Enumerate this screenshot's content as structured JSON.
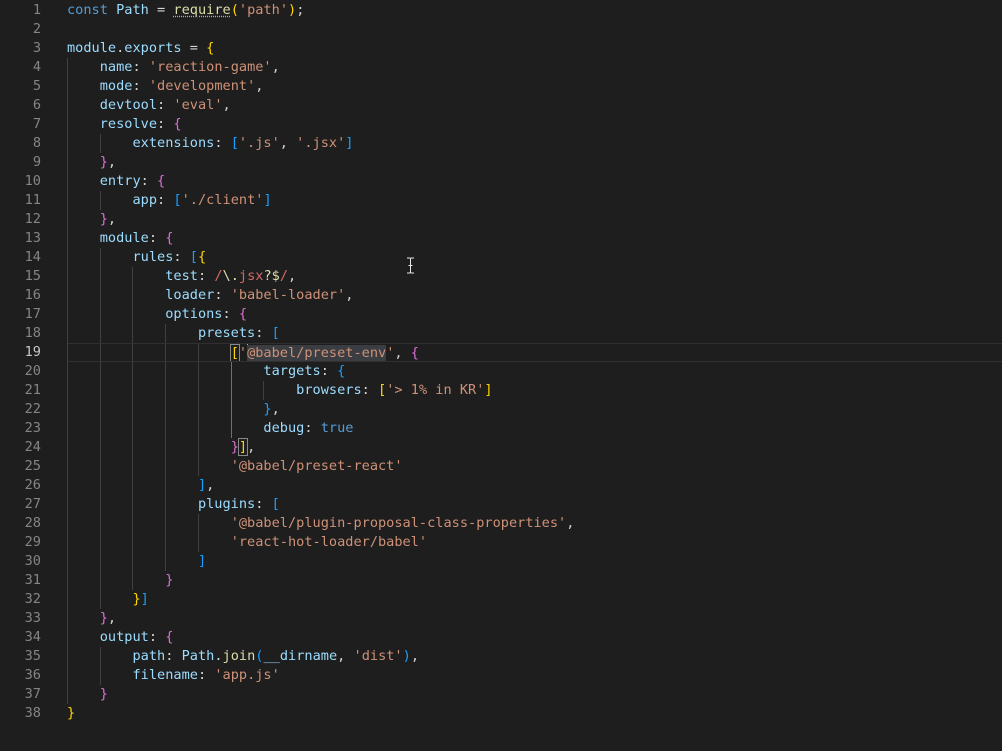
{
  "editor": {
    "language": "javascript",
    "current_line": 19,
    "lines": [
      {
        "n": "1",
        "indent": 0,
        "segs": [
          [
            "const",
            "kw"
          ],
          [
            " ",
            "pl"
          ],
          [
            "Path",
            "id"
          ],
          [
            " = ",
            "pl"
          ],
          [
            "require",
            "fn wavy"
          ],
          [
            "(",
            "b0"
          ],
          [
            "'path'",
            "str"
          ],
          [
            ")",
            "b0"
          ],
          [
            ";",
            "pl"
          ]
        ]
      },
      {
        "n": "2",
        "indent": 0,
        "segs": []
      },
      {
        "n": "3",
        "indent": 0,
        "segs": [
          [
            "module",
            "id"
          ],
          [
            ".",
            "pl"
          ],
          [
            "exports",
            "id"
          ],
          [
            " = ",
            "pl"
          ],
          [
            "{",
            "b0"
          ]
        ]
      },
      {
        "n": "4",
        "indent": 1,
        "segs": [
          [
            "name",
            "id"
          ],
          [
            ": ",
            "pl"
          ],
          [
            "'reaction-game'",
            "str"
          ],
          [
            ",",
            "pl"
          ]
        ]
      },
      {
        "n": "5",
        "indent": 1,
        "segs": [
          [
            "mode",
            "id"
          ],
          [
            ": ",
            "pl"
          ],
          [
            "'development'",
            "str"
          ],
          [
            ",",
            "pl"
          ]
        ]
      },
      {
        "n": "6",
        "indent": 1,
        "segs": [
          [
            "devtool",
            "id"
          ],
          [
            ": ",
            "pl"
          ],
          [
            "'eval'",
            "str"
          ],
          [
            ",",
            "pl"
          ]
        ]
      },
      {
        "n": "7",
        "indent": 1,
        "segs": [
          [
            "resolve",
            "id"
          ],
          [
            ": ",
            "pl"
          ],
          [
            "{",
            "b1"
          ]
        ]
      },
      {
        "n": "8",
        "indent": 2,
        "segs": [
          [
            "extensions",
            "id"
          ],
          [
            ": ",
            "pl"
          ],
          [
            "[",
            "b2"
          ],
          [
            "'.js'",
            "str"
          ],
          [
            ", ",
            "pl"
          ],
          [
            "'.jsx'",
            "str"
          ],
          [
            "]",
            "b2"
          ]
        ]
      },
      {
        "n": "9",
        "indent": 1,
        "segs": [
          [
            "}",
            "b1"
          ],
          [
            ",",
            "pl"
          ]
        ]
      },
      {
        "n": "10",
        "indent": 1,
        "segs": [
          [
            "entry",
            "id"
          ],
          [
            ": ",
            "pl"
          ],
          [
            "{",
            "b1"
          ]
        ]
      },
      {
        "n": "11",
        "indent": 2,
        "segs": [
          [
            "app",
            "id"
          ],
          [
            ": ",
            "pl"
          ],
          [
            "[",
            "b2"
          ],
          [
            "'./client'",
            "str"
          ],
          [
            "]",
            "b2"
          ]
        ]
      },
      {
        "n": "12",
        "indent": 1,
        "segs": [
          [
            "}",
            "b1"
          ],
          [
            ",",
            "pl"
          ]
        ]
      },
      {
        "n": "13",
        "indent": 1,
        "segs": [
          [
            "module",
            "id"
          ],
          [
            ": ",
            "pl"
          ],
          [
            "{",
            "b1"
          ]
        ]
      },
      {
        "n": "14",
        "indent": 2,
        "segs": [
          [
            "rules",
            "id"
          ],
          [
            ": ",
            "pl"
          ],
          [
            "[",
            "b2"
          ],
          [
            "{",
            "b0"
          ]
        ]
      },
      {
        "n": "15",
        "indent": 3,
        "segs": [
          [
            "test",
            "id"
          ],
          [
            ": ",
            "pl"
          ],
          [
            "/",
            "rx"
          ],
          [
            "\\.",
            "rxa"
          ],
          [
            "jsx",
            "rx"
          ],
          [
            "?$",
            "rxa"
          ],
          [
            "/",
            "rx"
          ],
          [
            ",",
            "pl"
          ]
        ]
      },
      {
        "n": "16",
        "indent": 3,
        "segs": [
          [
            "loader",
            "id"
          ],
          [
            ": ",
            "pl"
          ],
          [
            "'babel-loader'",
            "str"
          ],
          [
            ",",
            "pl"
          ]
        ]
      },
      {
        "n": "17",
        "indent": 3,
        "segs": [
          [
            "options",
            "id"
          ],
          [
            ": ",
            "pl"
          ],
          [
            "{",
            "b1"
          ]
        ]
      },
      {
        "n": "18",
        "indent": 4,
        "segs": [
          [
            "presets",
            "id"
          ],
          [
            ": ",
            "pl"
          ],
          [
            "[",
            "b2"
          ]
        ]
      },
      {
        "n": "19",
        "indent": 5,
        "segs": [
          [
            "[",
            "b0 bm"
          ],
          [
            "'",
            "str"
          ],
          [
            "|",
            "cursor"
          ],
          [
            "@babel/preset-env",
            "str sel"
          ],
          [
            "'",
            "str"
          ],
          [
            ", ",
            "pl"
          ],
          [
            "{",
            "b1"
          ]
        ]
      },
      {
        "n": "20",
        "indent": 6,
        "segs": [
          [
            "targets",
            "id"
          ],
          [
            ": ",
            "pl"
          ],
          [
            "{",
            "b2"
          ]
        ]
      },
      {
        "n": "21",
        "indent": 7,
        "segs": [
          [
            "browsers",
            "id"
          ],
          [
            ": ",
            "pl"
          ],
          [
            "[",
            "b0"
          ],
          [
            "'> 1% in KR'",
            "str"
          ],
          [
            "]",
            "b0"
          ]
        ]
      },
      {
        "n": "22",
        "indent": 6,
        "segs": [
          [
            "}",
            "b2"
          ],
          [
            ",",
            "pl"
          ]
        ]
      },
      {
        "n": "23",
        "indent": 6,
        "segs": [
          [
            "debug",
            "id"
          ],
          [
            ": ",
            "pl"
          ],
          [
            "true",
            "kw"
          ]
        ]
      },
      {
        "n": "24",
        "indent": 5,
        "segs": [
          [
            "}",
            "b1"
          ],
          [
            "]",
            "b0 bm"
          ],
          [
            ",",
            "pl"
          ]
        ]
      },
      {
        "n": "25",
        "indent": 5,
        "segs": [
          [
            "'@babel/preset-react'",
            "str"
          ]
        ]
      },
      {
        "n": "26",
        "indent": 4,
        "segs": [
          [
            "]",
            "b2"
          ],
          [
            ",",
            "pl"
          ]
        ]
      },
      {
        "n": "27",
        "indent": 4,
        "segs": [
          [
            "plugins",
            "id"
          ],
          [
            ": ",
            "pl"
          ],
          [
            "[",
            "b2"
          ]
        ]
      },
      {
        "n": "28",
        "indent": 5,
        "segs": [
          [
            "'@babel/plugin-proposal-class-properties'",
            "str"
          ],
          [
            ",",
            "pl"
          ]
        ]
      },
      {
        "n": "29",
        "indent": 5,
        "segs": [
          [
            "'react-hot-loader/babel'",
            "str"
          ]
        ]
      },
      {
        "n": "30",
        "indent": 4,
        "segs": [
          [
            "]",
            "b2"
          ]
        ]
      },
      {
        "n": "31",
        "indent": 3,
        "segs": [
          [
            "}",
            "b1"
          ]
        ]
      },
      {
        "n": "32",
        "indent": 2,
        "segs": [
          [
            "}",
            "b0"
          ],
          [
            "]",
            "b2"
          ]
        ]
      },
      {
        "n": "33",
        "indent": 1,
        "segs": [
          [
            "}",
            "b1"
          ],
          [
            ",",
            "pl"
          ]
        ]
      },
      {
        "n": "34",
        "indent": 1,
        "segs": [
          [
            "output",
            "id"
          ],
          [
            ": ",
            "pl"
          ],
          [
            "{",
            "b1"
          ]
        ]
      },
      {
        "n": "35",
        "indent": 2,
        "segs": [
          [
            "path",
            "id"
          ],
          [
            ": ",
            "pl"
          ],
          [
            "Path",
            "id"
          ],
          [
            ".",
            "pl"
          ],
          [
            "join",
            "fn"
          ],
          [
            "(",
            "b2"
          ],
          [
            "__dirname",
            "id"
          ],
          [
            ", ",
            "pl"
          ],
          [
            "'dist'",
            "str"
          ],
          [
            ")",
            "b2"
          ],
          [
            ",",
            "pl"
          ]
        ]
      },
      {
        "n": "36",
        "indent": 2,
        "segs": [
          [
            "filename",
            "id"
          ],
          [
            ": ",
            "pl"
          ],
          [
            "'app.js'",
            "str"
          ]
        ]
      },
      {
        "n": "37",
        "indent": 1,
        "segs": [
          [
            "}",
            "b1"
          ]
        ]
      },
      {
        "n": "38",
        "indent": 0,
        "segs": [
          [
            "}",
            "b0"
          ]
        ]
      }
    ],
    "active_guides": [
      {
        "from": 19,
        "to": 24,
        "level": 5
      }
    ]
  },
  "mouse_pointer": "text-ibeam-icon"
}
